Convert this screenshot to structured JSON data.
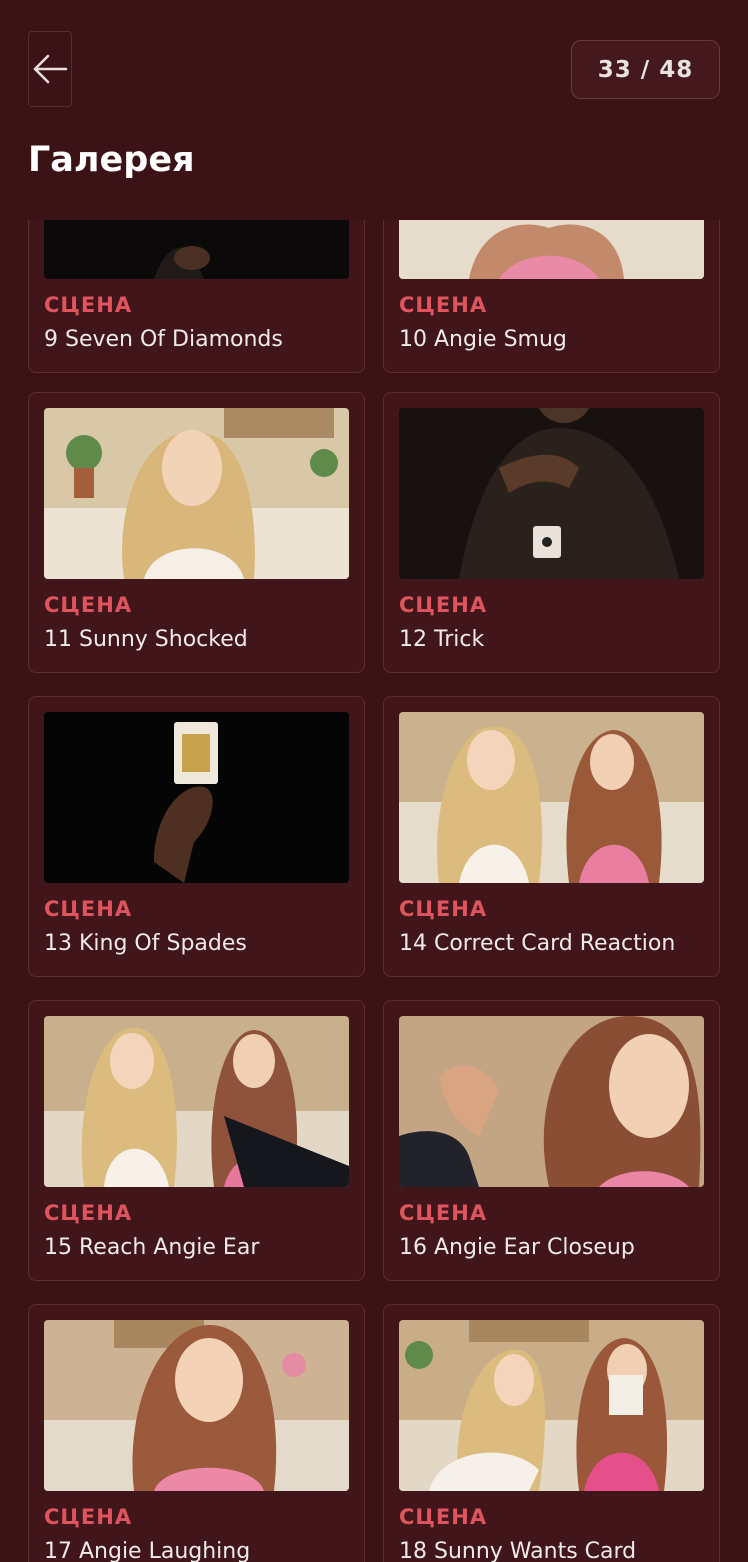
{
  "header": {
    "title": "Галерея",
    "counter": "33 / 48"
  },
  "icons": {
    "back": "arrow-left-icon"
  },
  "colors": {
    "background": "#3b1216",
    "accent": "#e0555d",
    "card": "#40161a"
  },
  "gallery": {
    "items": [
      {
        "kind": "СЦЕНА",
        "label": "9 Seven Of Diamonds"
      },
      {
        "kind": "СЦЕНА",
        "label": "10 Angie Smug"
      },
      {
        "kind": "СЦЕНА",
        "label": "11 Sunny Shocked"
      },
      {
        "kind": "СЦЕНА",
        "label": "12 Trick"
      },
      {
        "kind": "СЦЕНА",
        "label": "13 King Of Spades"
      },
      {
        "kind": "СЦЕНА",
        "label": "14 Correct Card Reaction"
      },
      {
        "kind": "СЦЕНА",
        "label": "15 Reach Angie Ear"
      },
      {
        "kind": "СЦЕНА",
        "label": "16 Angie Ear Closeup"
      },
      {
        "kind": "СЦЕНА",
        "label": "17 Angie Laughing"
      },
      {
        "kind": "СЦЕНА",
        "label": "18 Sunny Wants Card"
      }
    ]
  }
}
